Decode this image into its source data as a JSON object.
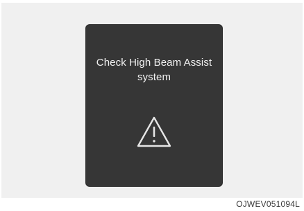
{
  "display": {
    "message": "Check High Beam Assist system",
    "icon": "warning-triangle-icon"
  },
  "figure_code": "OJWEV051094L",
  "colors": {
    "screen_bg": "#363636",
    "text": "#f2f2f2",
    "page_bg": "#f0f0f0"
  }
}
